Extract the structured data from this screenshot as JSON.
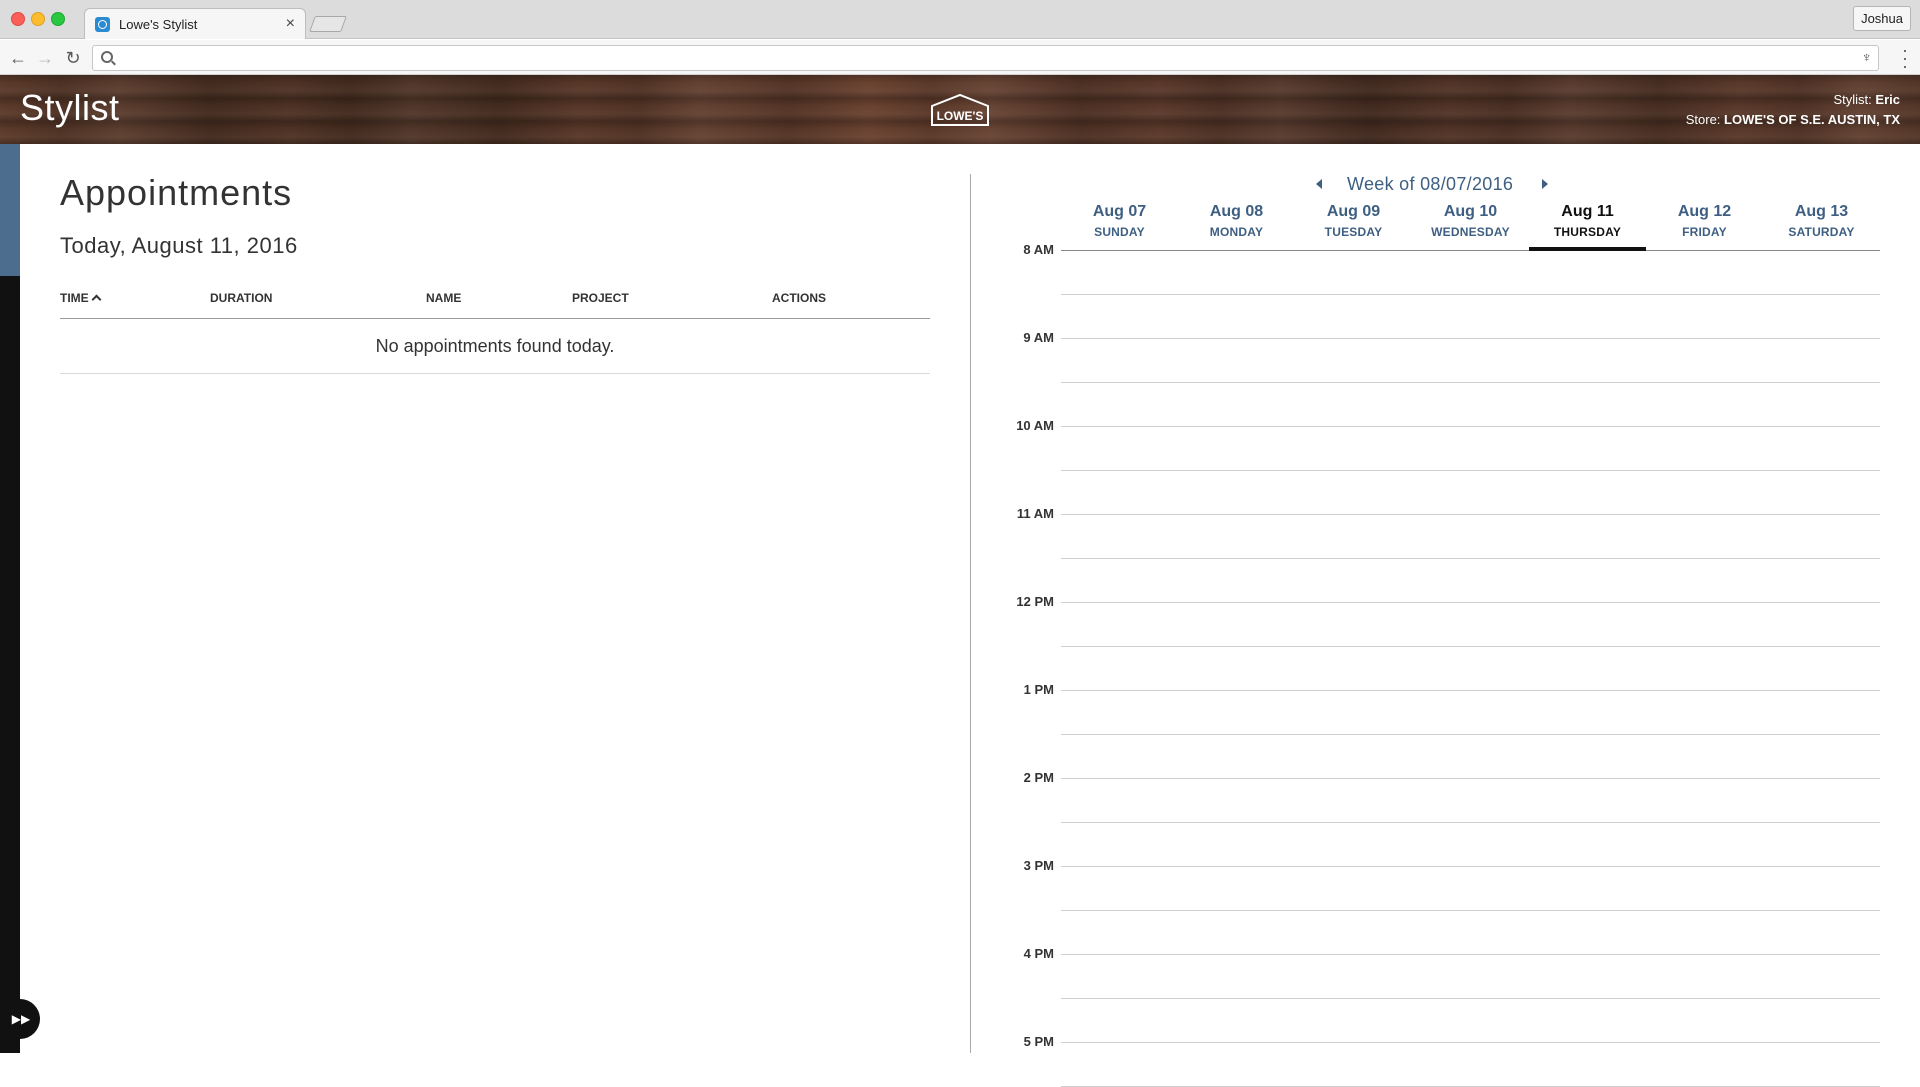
{
  "browser": {
    "tab_title": "Lowe's Stylist",
    "tab_close": "×",
    "profile_name": "Joshua",
    "back_glyph": "←",
    "forward_glyph": "→",
    "reload_glyph": "↻",
    "address_value": ""
  },
  "header": {
    "app_title": "Stylist",
    "logo_text": "LOWE'S",
    "stylist_label": "Stylist:",
    "stylist_name": "Eric",
    "store_label": "Store:",
    "store_name": "LOWE'S OF S.E. AUSTIN, TX"
  },
  "appointments": {
    "heading": "Appointments",
    "today_label": "Today, August 11, 2016",
    "columns": [
      "TIME",
      "DURATION",
      "NAME",
      "PROJECT",
      "ACTIONS"
    ],
    "empty_message": "No appointments found today."
  },
  "calendar": {
    "week_label": "Week of 08/07/2016",
    "days": [
      {
        "date": "Aug 07",
        "name": "SUNDAY"
      },
      {
        "date": "Aug 08",
        "name": "MONDAY"
      },
      {
        "date": "Aug 09",
        "name": "TUESDAY"
      },
      {
        "date": "Aug 10",
        "name": "WEDNESDAY"
      },
      {
        "date": "Aug 11",
        "name": "THURSDAY"
      },
      {
        "date": "Aug 12",
        "name": "FRIDAY"
      },
      {
        "date": "Aug 13",
        "name": "SATURDAY"
      }
    ],
    "active_day": 4,
    "hours": [
      "8 AM",
      "9 AM",
      "10 AM",
      "11 AM",
      "12 PM",
      "1 PM",
      "2 PM",
      "3 PM",
      "4 PM",
      "5 PM"
    ]
  },
  "colors": {
    "accent_blue": "#3e5f82",
    "rail_accent": "#4d6d8e",
    "rail": "#111111"
  }
}
